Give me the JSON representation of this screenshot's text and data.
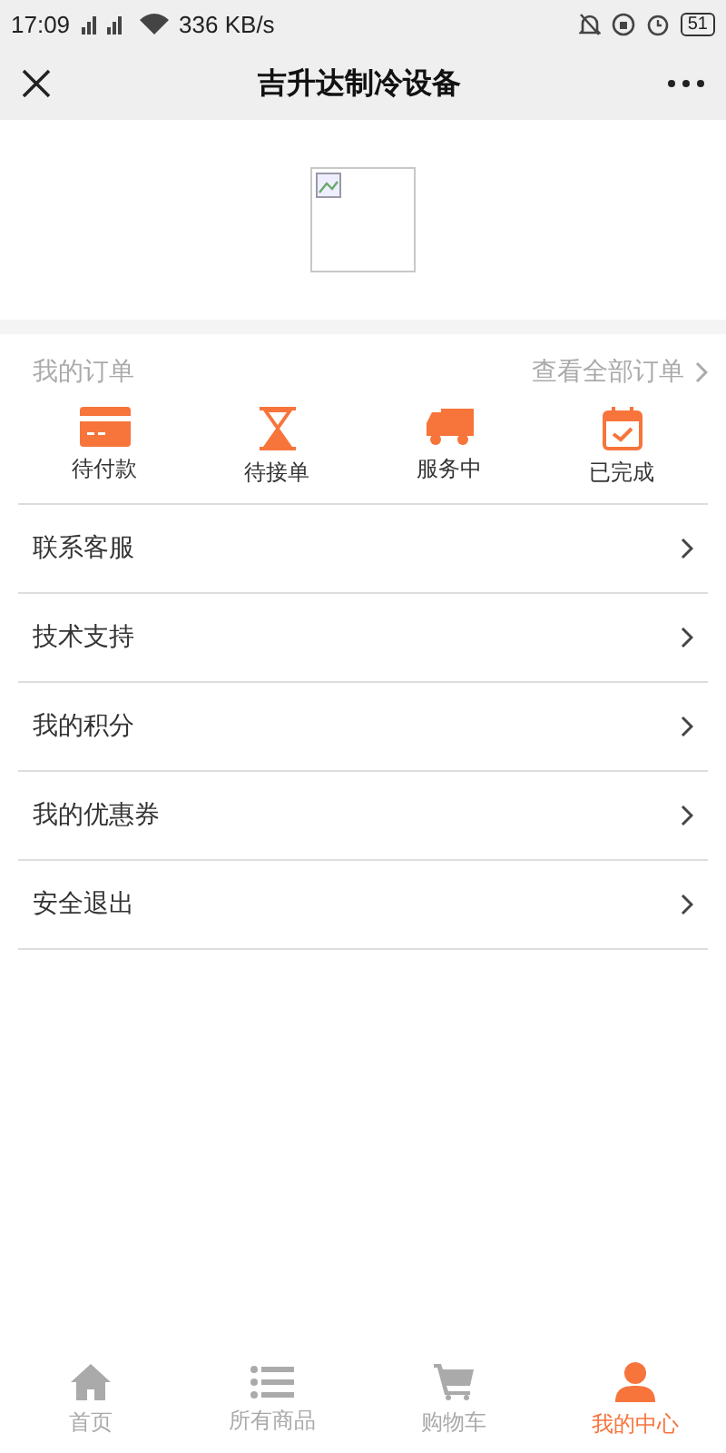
{
  "status_bar": {
    "time": "17:09",
    "speed": "336 KB/s",
    "battery": "51"
  },
  "header": {
    "title": "吉升达制冷设备"
  },
  "orders": {
    "title": "我的订单",
    "link": "查看全部订单",
    "items": [
      {
        "label": "待付款",
        "kind": "card"
      },
      {
        "label": "待接单",
        "kind": "hourglass"
      },
      {
        "label": "服务中",
        "kind": "truck"
      },
      {
        "label": "已完成",
        "kind": "calendar"
      }
    ]
  },
  "menu": [
    "联系客服",
    "技术支持",
    "我的积分",
    "我的优惠券",
    "安全退出"
  ],
  "tab_bar": [
    {
      "label": "首页",
      "kind": "home",
      "selected": false
    },
    {
      "label": "所有商品",
      "kind": "list",
      "selected": false
    },
    {
      "label": "购物车",
      "kind": "cart",
      "selected": false
    },
    {
      "label": "我的中心",
      "kind": "user",
      "selected": true
    }
  ]
}
